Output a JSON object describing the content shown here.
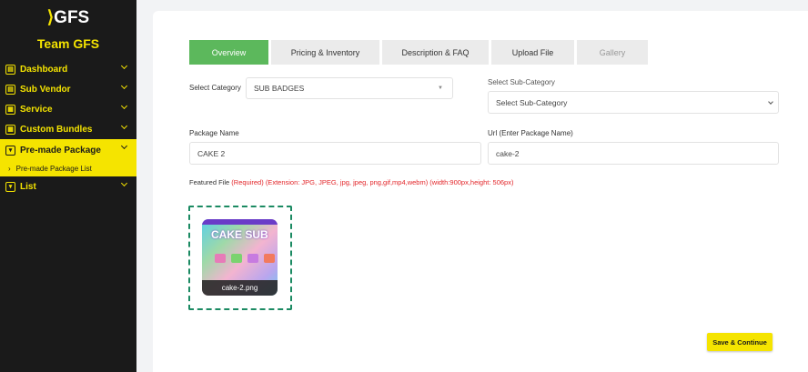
{
  "sidebar": {
    "logo_text": "GFS",
    "team_title": "Team GFS",
    "items": [
      {
        "label": "Dashboard",
        "icon": "dashboard-icon"
      },
      {
        "label": "Sub Vendor",
        "icon": "vendor-icon"
      },
      {
        "label": "Service",
        "icon": "service-icon"
      },
      {
        "label": "Custom Bundles",
        "icon": "bundle-icon"
      },
      {
        "label": "Pre-made Package",
        "icon": "package-icon",
        "active": true
      },
      {
        "label": "List",
        "icon": "list-icon"
      }
    ],
    "subitem": {
      "label": "Pre-made Package List",
      "arrow": "›"
    }
  },
  "tabs": [
    {
      "label": "Overview"
    },
    {
      "label": "Pricing & Inventory"
    },
    {
      "label": "Description & FAQ"
    },
    {
      "label": "Upload File"
    },
    {
      "label": "Gallery"
    }
  ],
  "form": {
    "category_label": "Select Category",
    "category_value": "SUB BADGES",
    "subcategory_label": "Select Sub-Category",
    "subcategory_value": "Select Sub-Category",
    "package_name_label": "Package Name",
    "package_name_value": "CAKE 2",
    "url_label": "Url (Enter Package Name)",
    "url_value": "cake-2",
    "featured_label": "Featured File",
    "featured_required": "(Required)",
    "featured_ext": "(Extension: JPG, JPEG, jpg, jpeg, png,gif,mp4,webm) (width:900px,height: 506px)"
  },
  "file": {
    "thumb_title": "CAKE SUB",
    "filename": "cake-2.png"
  },
  "actions": {
    "save_label": "Save & Continue"
  },
  "colors": {
    "accent": "#f5e400",
    "tab_active": "#5cb85c",
    "required": "#e3262a",
    "dropzone": "#1b8a62"
  }
}
